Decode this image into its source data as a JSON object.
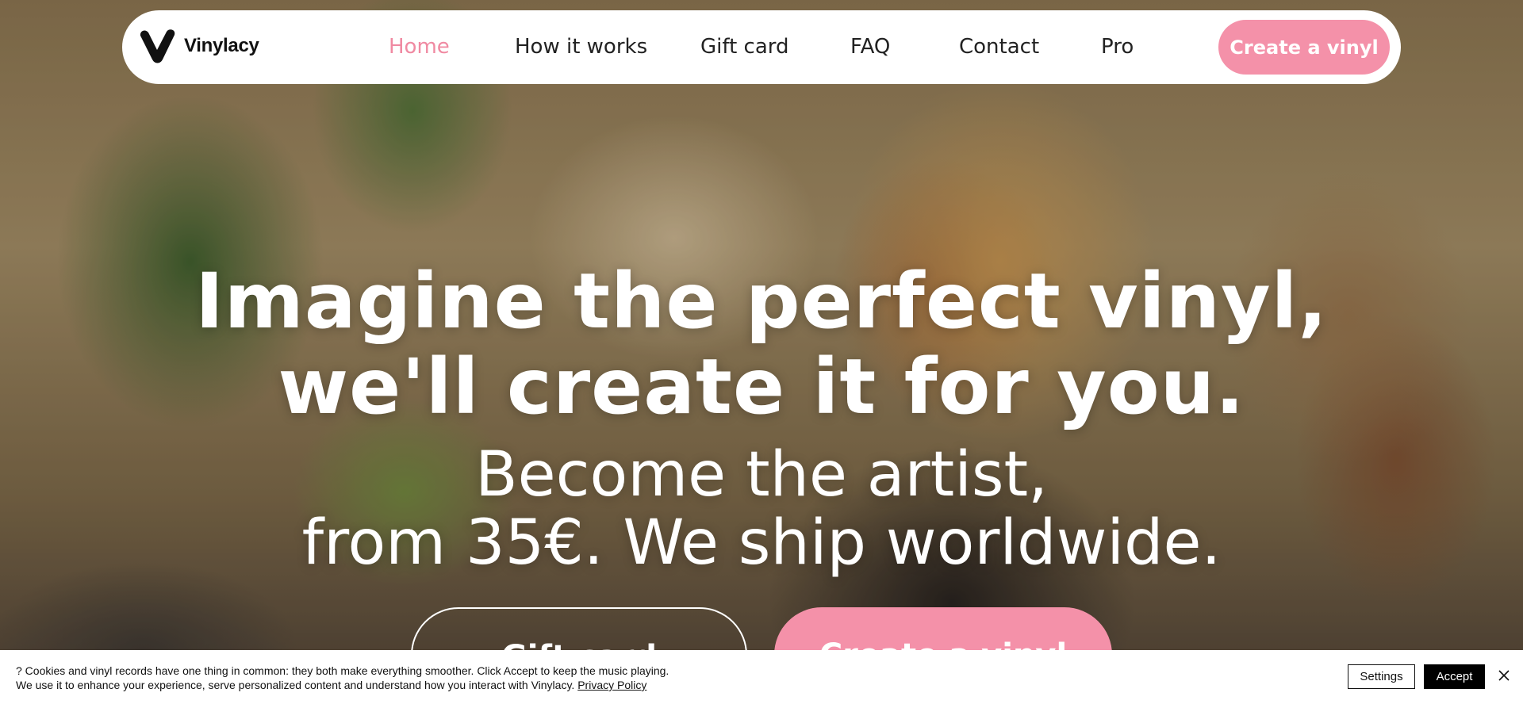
{
  "brand": {
    "name": "Vinylacy",
    "logo_icon": "v-logo-icon"
  },
  "nav": {
    "items": [
      {
        "label": "Home",
        "active": true
      },
      {
        "label": "How it works",
        "active": false
      },
      {
        "label": "Gift card",
        "active": false
      },
      {
        "label": "FAQ",
        "active": false
      },
      {
        "label": "Contact",
        "active": false
      },
      {
        "label": "Pro",
        "active": false
      }
    ],
    "cta_label": "Create a vinyl"
  },
  "hero": {
    "headline_line1": "Imagine the perfect vinyl,",
    "headline_line2": "we'll create it for you.",
    "subline_line1": "Become the artist,",
    "subline_line2": "from 35€. We ship worldwide.",
    "button_outline_label": "Gift card",
    "button_filled_label": "Create a vinyl"
  },
  "cookie_banner": {
    "line1": "? Cookies and vinyl records have one thing in common: they both make everything smoother. Click Accept to keep the music playing.",
    "line2": "We use it to enhance your experience, serve personalized content and understand how you interact with Vinylacy.",
    "privacy_link": "Privacy Policy",
    "settings_label": "Settings",
    "accept_label": "Accept",
    "close_icon": "close-icon"
  },
  "colors": {
    "accent_pink": "#f491a9",
    "active_nav_pink": "#f08aa2",
    "nav_bg": "#ffffff",
    "banner_bg": "#ffffff",
    "accept_bg": "#000000"
  }
}
